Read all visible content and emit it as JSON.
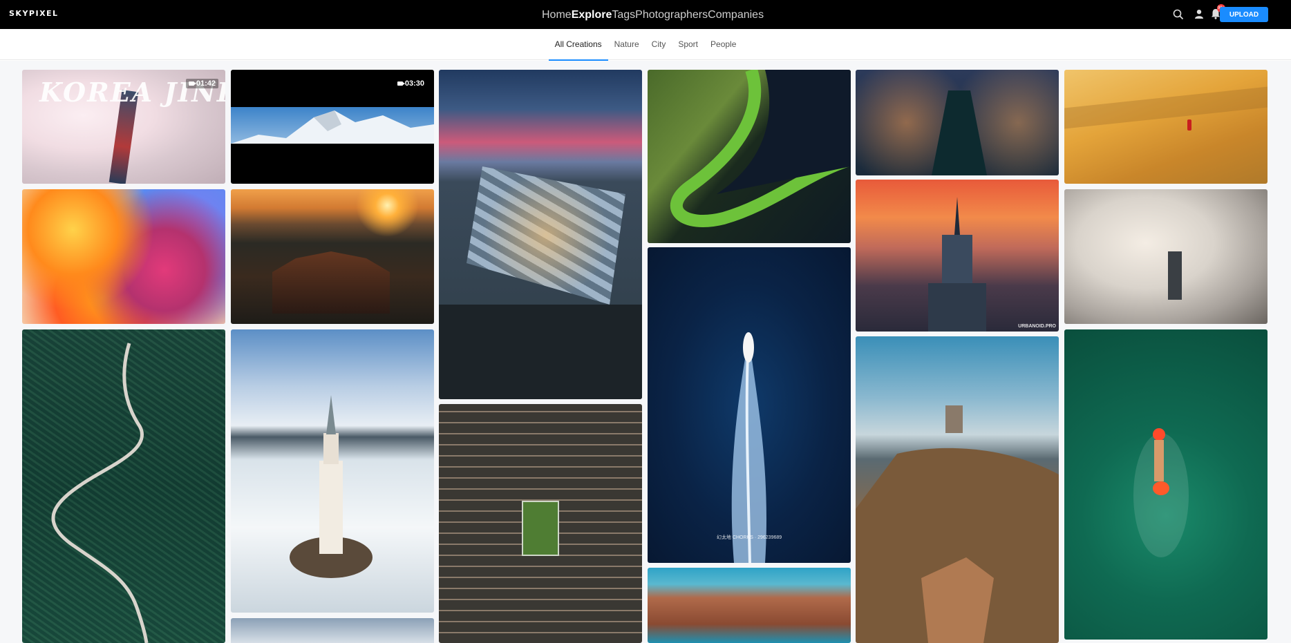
{
  "brand": {
    "logo": "SKYPIXEL"
  },
  "nav": {
    "links": [
      "Home",
      "Explore",
      "Tags",
      "Photographers",
      "Companies"
    ],
    "active": "Explore"
  },
  "tools": {
    "upload_label": "UPLOAD",
    "notification_count": "99+",
    "icons": [
      "search-icon",
      "user-icon",
      "bell-icon"
    ]
  },
  "subnav": {
    "tabs": [
      "All Creations",
      "Nature",
      "City",
      "Sport",
      "People"
    ],
    "active": "All Creations"
  },
  "gallery": {
    "tiles": [
      {
        "label": "KOREA JINHAE",
        "duration": "01:42",
        "type": "video"
      },
      {
        "duration": "03:30",
        "type": "video"
      },
      {
        "type": "photo"
      },
      {
        "type": "photo"
      },
      {
        "type": "photo"
      },
      {
        "type": "photo"
      },
      {
        "type": "photo"
      },
      {
        "type": "photo"
      },
      {
        "type": "photo",
        "watermark": "URBANOID.PRO"
      },
      {
        "type": "photo"
      },
      {
        "type": "photo"
      },
      {
        "type": "photo"
      },
      {
        "type": "photo",
        "watermark": "幻太地 CHORKS · 296239689"
      },
      {
        "type": "photo"
      },
      {
        "type": "photo"
      },
      {
        "type": "photo"
      },
      {
        "type": "photo"
      },
      {
        "type": "photo"
      }
    ]
  },
  "colors": {
    "accent": "#1a8cff",
    "topbar": "#000000"
  }
}
